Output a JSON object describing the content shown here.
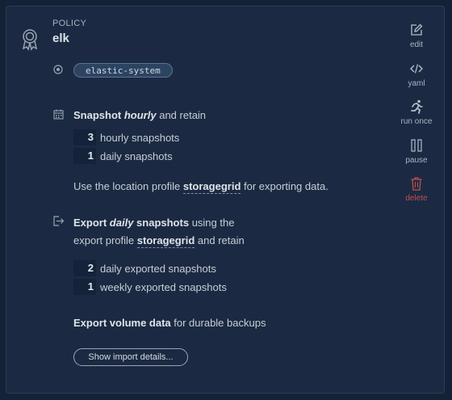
{
  "policy": {
    "label": "POLICY",
    "name": "elk",
    "namespace": "elastic-system"
  },
  "actions": [
    {
      "label": "edit",
      "icon": "edit-icon"
    },
    {
      "label": "yaml",
      "icon": "code-icon"
    },
    {
      "label": "run once",
      "icon": "running-person-icon"
    },
    {
      "label": "pause",
      "icon": "pause-icon"
    },
    {
      "label": "delete",
      "icon": "trash-icon"
    }
  ],
  "snapshot": {
    "prefix": "Snapshot",
    "frequency": "hourly",
    "suffix": "and retain",
    "retention": [
      {
        "count": "3",
        "label": "hourly snapshots"
      },
      {
        "count": "1",
        "label": "daily snapshots"
      }
    ],
    "location_prefix": "Use the location profile",
    "location_profile": "storagegrid",
    "location_suffix": "for exporting data."
  },
  "export": {
    "prefix": "Export",
    "frequency": "daily",
    "snapshots_word": "snapshots",
    "using": "using the",
    "profile_prefix": "export profile",
    "profile": "storagegrid",
    "profile_suffix": "and retain",
    "retention": [
      {
        "count": "2",
        "label": "daily exported snapshots"
      },
      {
        "count": "1",
        "label": "weekly exported snapshots"
      }
    ],
    "volume_bold": "Export volume data",
    "volume_rest": "for durable backups"
  },
  "import_button": "Show import details...",
  "colors": {
    "background": "#142238",
    "card": "#1b2a42",
    "danger": "#c0504f",
    "badge": "#2c4462"
  }
}
